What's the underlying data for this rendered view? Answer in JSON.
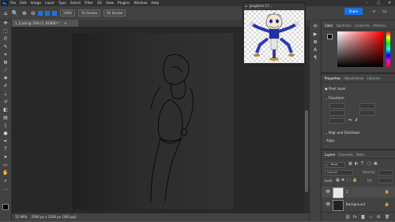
{
  "app": {
    "logo": "Ps",
    "menu": [
      "File",
      "Edit",
      "Image",
      "Layer",
      "Type",
      "Select",
      "Filter",
      "3D",
      "View",
      "Plugins",
      "Window",
      "Help"
    ],
    "window_controls": [
      "–",
      "▢",
      "✕"
    ]
  },
  "options_bar": {
    "zoom_value": "100%",
    "fit_screen": "Fit Screen",
    "fill_screen": "Fill Screen",
    "share": "Share"
  },
  "document": {
    "tab_title": "1_2.psd @ 33% (1, RGB/8) *",
    "tab_close": "×",
    "zoom_status": "32.99%",
    "size_status": "2006 px x 2036 px (300 ppi)"
  },
  "float_window": {
    "title": "Jangform-17..."
  },
  "color_panel": {
    "tabs": [
      "Color",
      "Swatches",
      "Gradients",
      "Patterns"
    ],
    "active_tab": "Color"
  },
  "properties_panel": {
    "tabs": [
      "Properties",
      "Adjustments",
      "Libraries"
    ],
    "layer_type": "Pixel Layer",
    "transform_heading": "Transform",
    "align_heading": "Align and Distribute",
    "align_label": "Align:"
  },
  "layers_panel": {
    "tabs": [
      "Layers",
      "Channels",
      "Paths"
    ],
    "filter_kind": "Kind",
    "blend_mode": "Normal",
    "opacity_label": "Opacity:",
    "lock_label": "Lock:",
    "fill_label": "Fill:",
    "layers": [
      {
        "name": "1",
        "thumb_color": "#e8e8e8",
        "locked": true
      },
      {
        "name": "Background",
        "thumb_color": "#222222",
        "locked": true
      }
    ]
  },
  "colors": {
    "accent": "#1473e6",
    "foreground_swatch": "#000000",
    "background_swatch": "#ffffff",
    "picked_hue": "#ff0000"
  }
}
